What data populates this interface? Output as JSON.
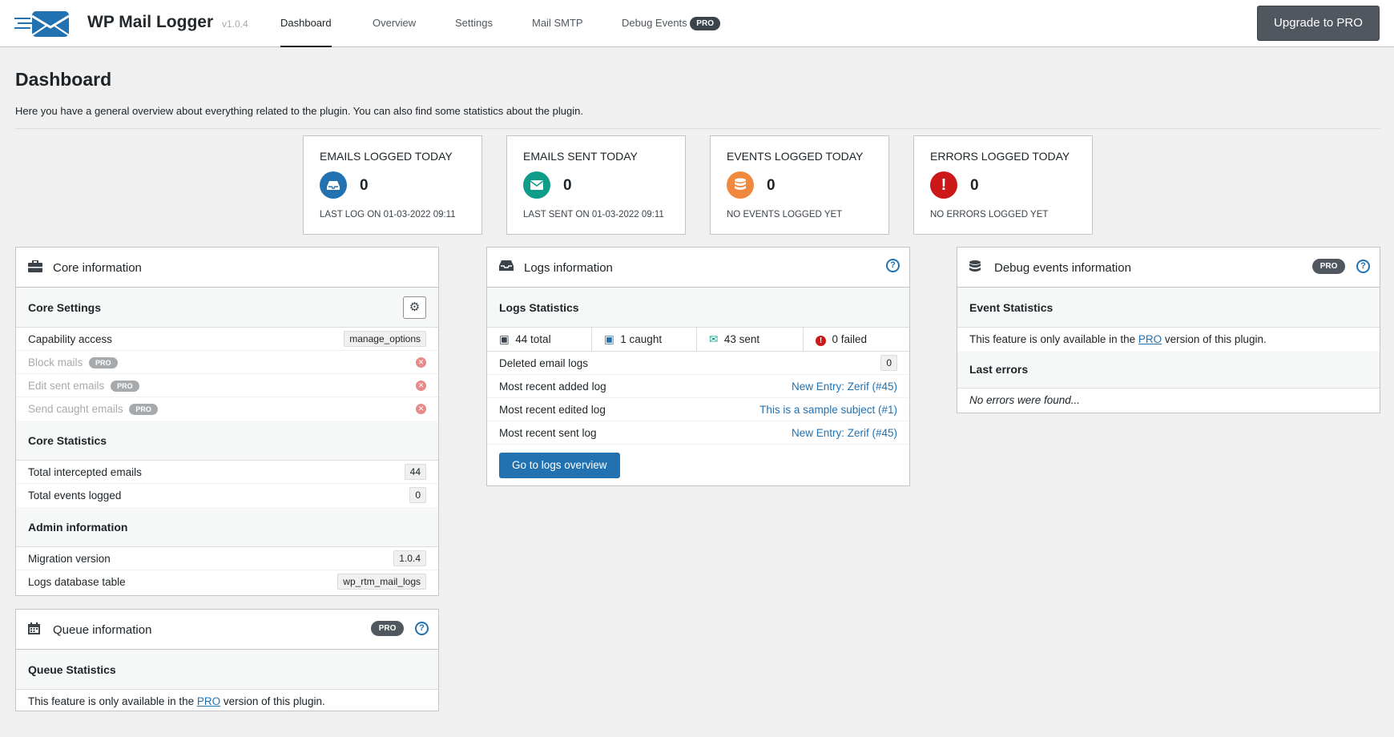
{
  "header": {
    "brand": "WP Mail Logger",
    "version": "v1.0.4",
    "nav": [
      {
        "label": "Dashboard"
      },
      {
        "label": "Overview"
      },
      {
        "label": "Settings"
      },
      {
        "label": "Mail SMTP"
      },
      {
        "label": "Debug Events",
        "badge": "PRO"
      }
    ],
    "upgrade_label": "Upgrade to PRO"
  },
  "page": {
    "title": "Dashboard",
    "description": "Here you have a general overview about everything related to the plugin. You can also find some statistics about the plugin."
  },
  "stats": [
    {
      "title": "EMAILS LOGGED TODAY",
      "value": "0",
      "sub": "LAST LOG ON 01-03-2022 09:11",
      "color": "#2271b1",
      "icon": "inbox-icon"
    },
    {
      "title": "EMAILS SENT TODAY",
      "value": "0",
      "sub": "LAST SENT ON 01-03-2022 09:11",
      "color": "#0f9d8a",
      "icon": "envelope-icon"
    },
    {
      "title": "EVENTS LOGGED TODAY",
      "value": "0",
      "sub": "NO EVENTS LOGGED YET",
      "color": "#f0883e",
      "icon": "database-icon"
    },
    {
      "title": "ERRORS LOGGED TODAY",
      "value": "0",
      "sub": "NO ERRORS LOGGED YET",
      "color": "#cc1818",
      "icon": "exclamation-icon"
    }
  ],
  "core": {
    "title": "Core information",
    "settings_head": "Core Settings",
    "capability_label": "Capability access",
    "capability_value": "manage_options",
    "block_label": "Block mails",
    "edit_label": "Edit sent emails",
    "send_label": "Send caught emails",
    "pro": "PRO",
    "statistics_head": "Core Statistics",
    "intercepted_label": "Total intercepted emails",
    "intercepted_value": "44",
    "events_label": "Total events logged",
    "events_value": "0",
    "admin_head": "Admin information",
    "migration_label": "Migration version",
    "migration_value": "1.0.4",
    "table_label": "Logs database table",
    "table_value": "wp_rtm_mail_logs"
  },
  "queue": {
    "title": "Queue information",
    "badge": "PRO",
    "stats_head": "Queue Statistics",
    "text_before": "This feature is only available in the ",
    "pro_link": "PRO",
    "text_after": " version of this plugin."
  },
  "logs": {
    "title": "Logs information",
    "stats_head": "Logs Statistics",
    "total": "44 total",
    "caught": "1 caught",
    "sent": "43 sent",
    "failed": "0 failed",
    "deleted_label": "Deleted email logs",
    "deleted_value": "0",
    "recent_added_label": "Most recent added log",
    "recent_added_value": "New Entry: Zerif (#45)",
    "recent_edited_label": "Most recent edited log",
    "recent_edited_value": "This is a sample subject (#1)",
    "recent_sent_label": "Most recent sent log",
    "recent_sent_value": "New Entry: Zerif (#45)",
    "button": "Go to logs overview"
  },
  "debug": {
    "title": "Debug events information",
    "badge": "PRO",
    "event_head": "Event Statistics",
    "text_before": "This feature is only available in the ",
    "pro_link": "PRO",
    "text_after": " version of this plugin.",
    "errors_head": "Last errors",
    "no_errors": "No errors were found..."
  }
}
